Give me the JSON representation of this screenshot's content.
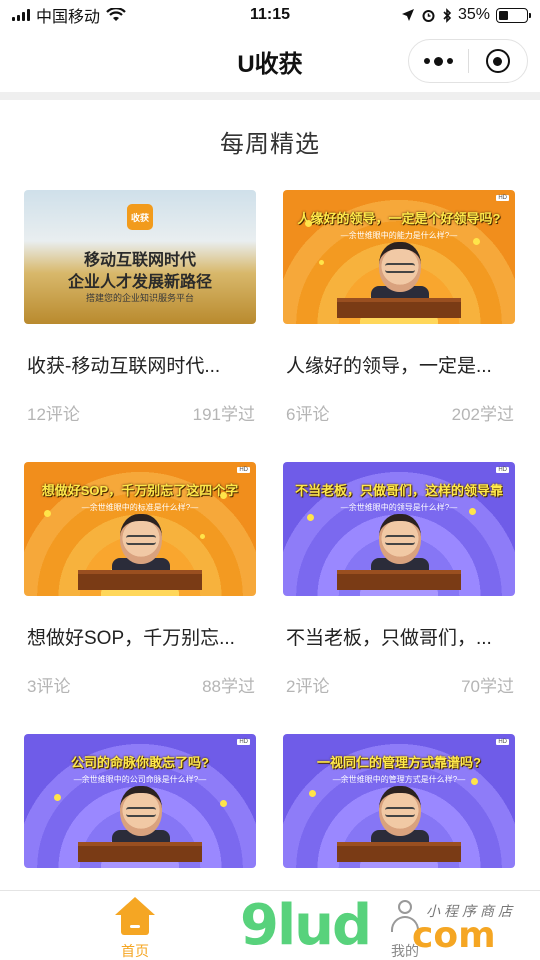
{
  "status_bar": {
    "carrier": "中国移动",
    "time": "11:15",
    "battery": "35%",
    "battery_level": 0.35
  },
  "nav": {
    "title": "U收获",
    "more_icon": "more-dots-icon",
    "close_icon": "mini-program-close-icon"
  },
  "section": {
    "title": "每周精选"
  },
  "cards": [
    {
      "title": "收获-移动互联网时代...",
      "comments": "12评论",
      "learners": "191学过",
      "thumb": {
        "style": "field",
        "logo": "收获",
        "line1": "移动互联网时代",
        "line2": "企业人才发展新路径",
        "line3": "搭建您的企业知识服务平台"
      }
    },
    {
      "title": "人缘好的领导，一定是...",
      "comments": "6评论",
      "learners": "202学过",
      "thumb": {
        "style": "orange",
        "banner": "人缘好的领导，一定是个好领导吗?",
        "sub": "—余世维眼中的能力是什么样?—",
        "badge": "HD"
      }
    },
    {
      "title": "想做好SOP，千万别忘...",
      "comments": "3评论",
      "learners": "88学过",
      "thumb": {
        "style": "orange",
        "banner": "想做好SOP，千万别忘了这四个字",
        "sub": "—余世维眼中的标准是什么样?—",
        "badge": "HD"
      }
    },
    {
      "title": "不当老板，只做哥们，...",
      "comments": "2评论",
      "learners": "70学过",
      "thumb": {
        "style": "purple",
        "banner": "不当老板，只做哥们，这样的领导靠谱吗?",
        "sub": "—余世维眼中的领导是什么样?—",
        "badge": "HD"
      }
    },
    {
      "title": "",
      "comments": "",
      "learners": "",
      "thumb": {
        "style": "purple",
        "banner": "公司的命脉你敢忘了吗?",
        "sub": "—余世维眼中的公司命脉是什么样?—",
        "badge": "HD"
      }
    },
    {
      "title": "",
      "comments": "",
      "learners": "",
      "thumb": {
        "style": "purple",
        "banner": "一视同仁的管理方式靠谱吗?",
        "sub": "—余世维眼中的管理方式是什么样?—",
        "badge": "HD"
      }
    }
  ],
  "tab_bar": {
    "home_label": "首页",
    "mine_label": "我的",
    "active_color": "#f5a623"
  },
  "watermark": {
    "main": "9lud",
    "com": "com",
    "shop": "小程序商店"
  }
}
